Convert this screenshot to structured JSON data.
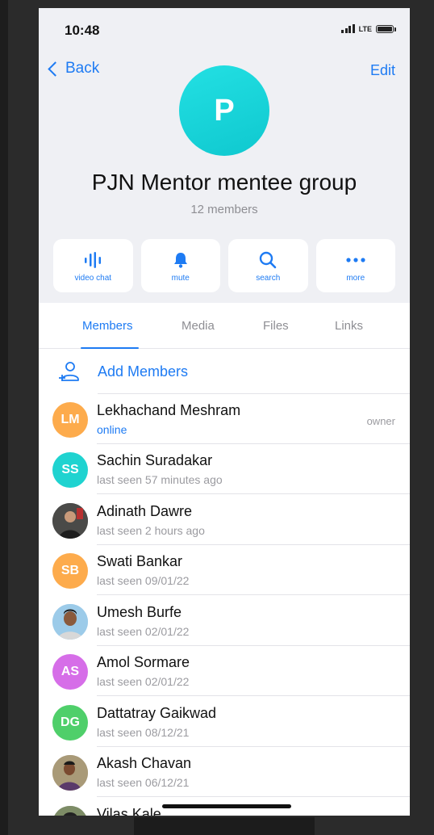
{
  "status_bar": {
    "time": "10:48",
    "network": "LTE"
  },
  "nav": {
    "back_label": "Back",
    "edit_label": "Edit"
  },
  "group": {
    "avatar_letter": "P",
    "title": "PJN Mentor mentee group",
    "subtitle": "12 members"
  },
  "actions": [
    {
      "label": "video chat",
      "icon": "video-chat-icon"
    },
    {
      "label": "mute",
      "icon": "bell-icon"
    },
    {
      "label": "search",
      "icon": "search-icon"
    },
    {
      "label": "more",
      "icon": "more-icon"
    }
  ],
  "tabs": [
    {
      "label": "Members",
      "active": true
    },
    {
      "label": "Media",
      "active": false
    },
    {
      "label": "Files",
      "active": false
    },
    {
      "label": "Links",
      "active": false
    }
  ],
  "add_members_label": "Add Members",
  "members": [
    {
      "name": "Lekhachand Meshram",
      "status": "online",
      "initials": "LM",
      "role": "owner",
      "color": "#fdab4c",
      "online": true
    },
    {
      "name": "Sachin Suradakar",
      "status": "last seen 57 minutes ago",
      "initials": "SS",
      "color": "#1fd3d0"
    },
    {
      "name": "Adinath Dawre",
      "status": "last seen 2 hours ago",
      "initials": "",
      "color": "#3a3a3a",
      "photo": true
    },
    {
      "name": "Swati Bankar",
      "status": "last seen 09/01/22",
      "initials": "SB",
      "color": "#fdab4c"
    },
    {
      "name": "Umesh Burfe",
      "status": "last seen 02/01/22",
      "initials": "",
      "color": "#8fc4e8",
      "photo": true
    },
    {
      "name": "Amol Sormare",
      "status": "last seen 02/01/22",
      "initials": "AS",
      "color": "#d66ee8"
    },
    {
      "name": "Dattatray Gaikwad",
      "status": "last seen 08/12/21",
      "initials": "DG",
      "color": "#4fcf6a"
    },
    {
      "name": "Akash Chavan",
      "status": "last seen 06/12/21",
      "initials": "",
      "color": "#9c8a6a",
      "photo": true
    },
    {
      "name": "Vilas Kale",
      "status": "",
      "initials": "",
      "color": "#6b7a5a",
      "photo": true
    }
  ],
  "colors": {
    "accent": "#1e7bf3",
    "group_avatar": "#18d4d8"
  }
}
